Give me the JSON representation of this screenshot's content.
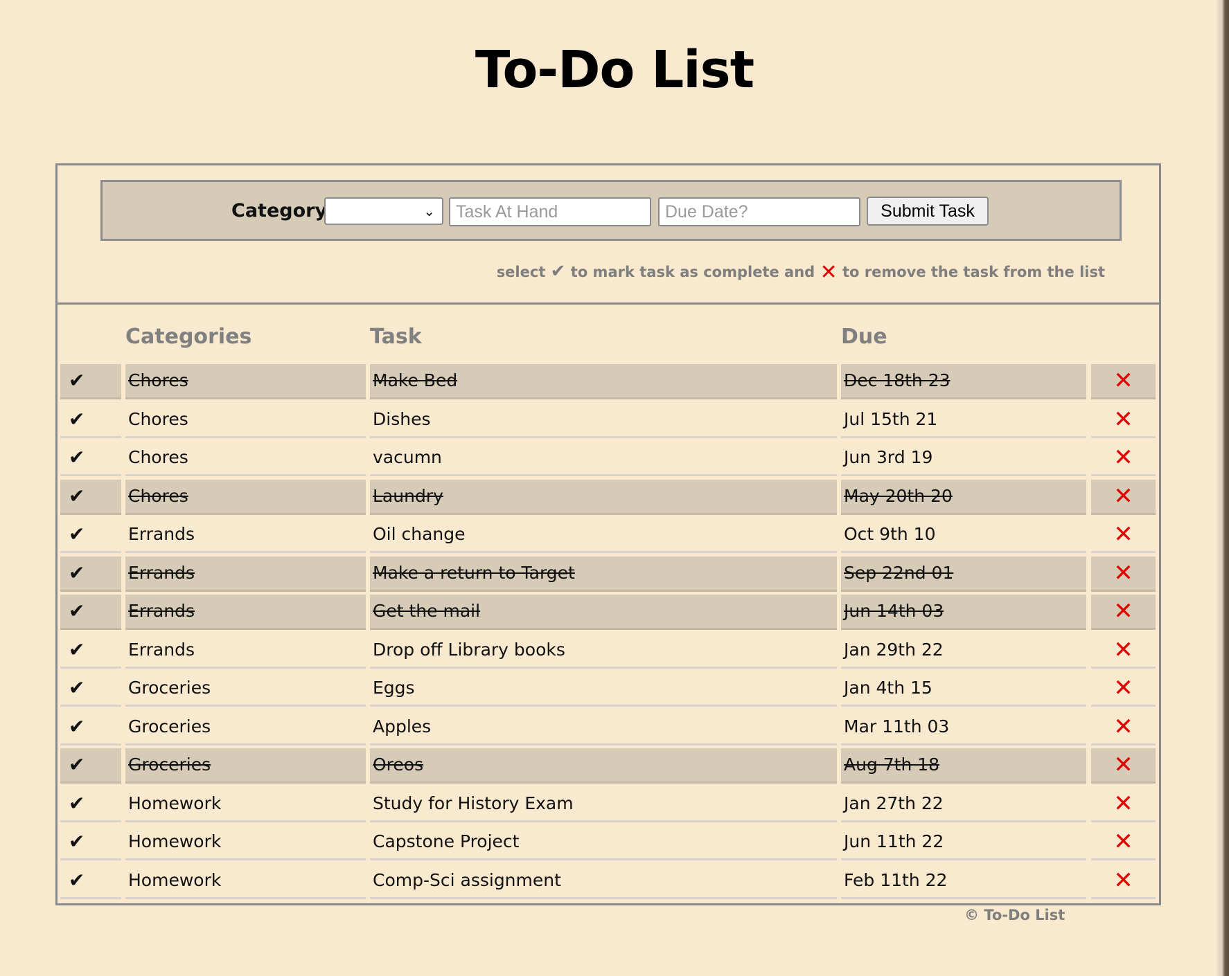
{
  "title": "To-Do List",
  "form": {
    "category_label": "Category",
    "category_selected": "",
    "task_placeholder": "Task At Hand",
    "due_placeholder": "Due Date?",
    "submit_label": "Submit Task"
  },
  "hint": {
    "part1": "select",
    "check_glyph": "✔",
    "part2": "to mark task as complete and",
    "x_glyph": "✕",
    "part3": "to remove the task from the list"
  },
  "columns": {
    "categories": "Categories",
    "task": "Task",
    "due": "Due"
  },
  "icons": {
    "check": "✔",
    "remove": "✕"
  },
  "colors": {
    "background": "#f9e9cf",
    "completed_row": "#d6cbb7",
    "remove_icon": "#e00000"
  },
  "tasks": [
    {
      "category": "Chores",
      "task": "Make Bed",
      "due": "Dec 18th 23",
      "completed": true
    },
    {
      "category": "Chores",
      "task": "Dishes",
      "due": "Jul 15th 21",
      "completed": false
    },
    {
      "category": "Chores",
      "task": "vacumn",
      "due": "Jun 3rd 19",
      "completed": false
    },
    {
      "category": "Chores",
      "task": "Laundry",
      "due": "May 20th 20",
      "completed": true
    },
    {
      "category": "Errands",
      "task": "Oil change",
      "due": "Oct 9th 10",
      "completed": false
    },
    {
      "category": "Errands",
      "task": "Make a return to Target",
      "due": "Sep 22nd 01",
      "completed": true
    },
    {
      "category": "Errands",
      "task": "Get the mail",
      "due": "Jun 14th 03",
      "completed": true
    },
    {
      "category": "Errands",
      "task": "Drop off Library books",
      "due": "Jan 29th 22",
      "completed": false
    },
    {
      "category": "Groceries",
      "task": "Eggs",
      "due": "Jan 4th 15",
      "completed": false
    },
    {
      "category": "Groceries",
      "task": "Apples",
      "due": "Mar 11th 03",
      "completed": false
    },
    {
      "category": "Groceries",
      "task": "Oreos",
      "due": "Aug 7th 18",
      "completed": true
    },
    {
      "category": "Homework",
      "task": "Study for History Exam",
      "due": "Jan 27th 22",
      "completed": false
    },
    {
      "category": "Homework",
      "task": "Capstone Project",
      "due": "Jun 11th 22",
      "completed": false
    },
    {
      "category": "Homework",
      "task": "Comp-Sci assignment",
      "due": "Feb 11th 22",
      "completed": false
    }
  ],
  "footer": "© To-Do List"
}
